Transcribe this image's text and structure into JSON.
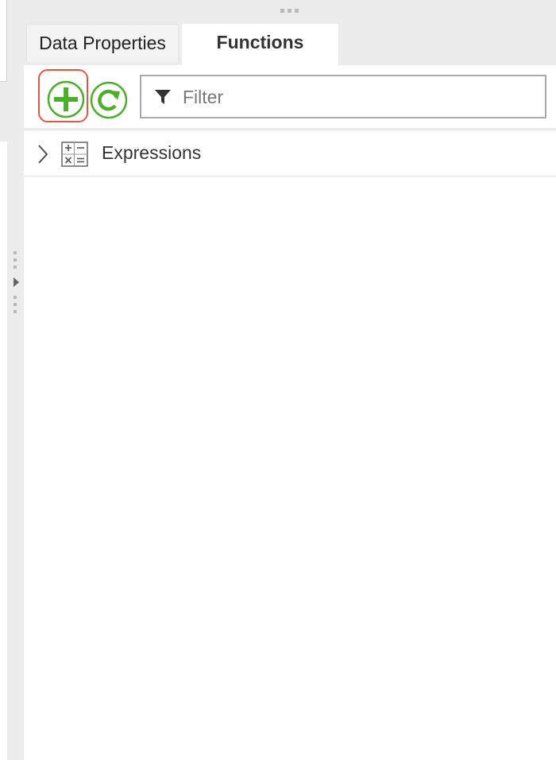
{
  "tabs": [
    {
      "label": "Data Properties",
      "active": false
    },
    {
      "label": "Functions",
      "active": true
    }
  ],
  "toolbar": {
    "add_icon": "plus-circle-icon",
    "refresh_icon": "refresh-icon",
    "filter": {
      "icon": "funnel-icon",
      "placeholder": "Filter",
      "value": ""
    }
  },
  "tree": {
    "items": [
      {
        "label": "Expressions",
        "icon": "calculator-icon",
        "expanded": false
      }
    ]
  },
  "colors": {
    "accent_green": "#4caf2a",
    "highlight_red": "#e8553e",
    "panel_gray": "#ececec"
  }
}
